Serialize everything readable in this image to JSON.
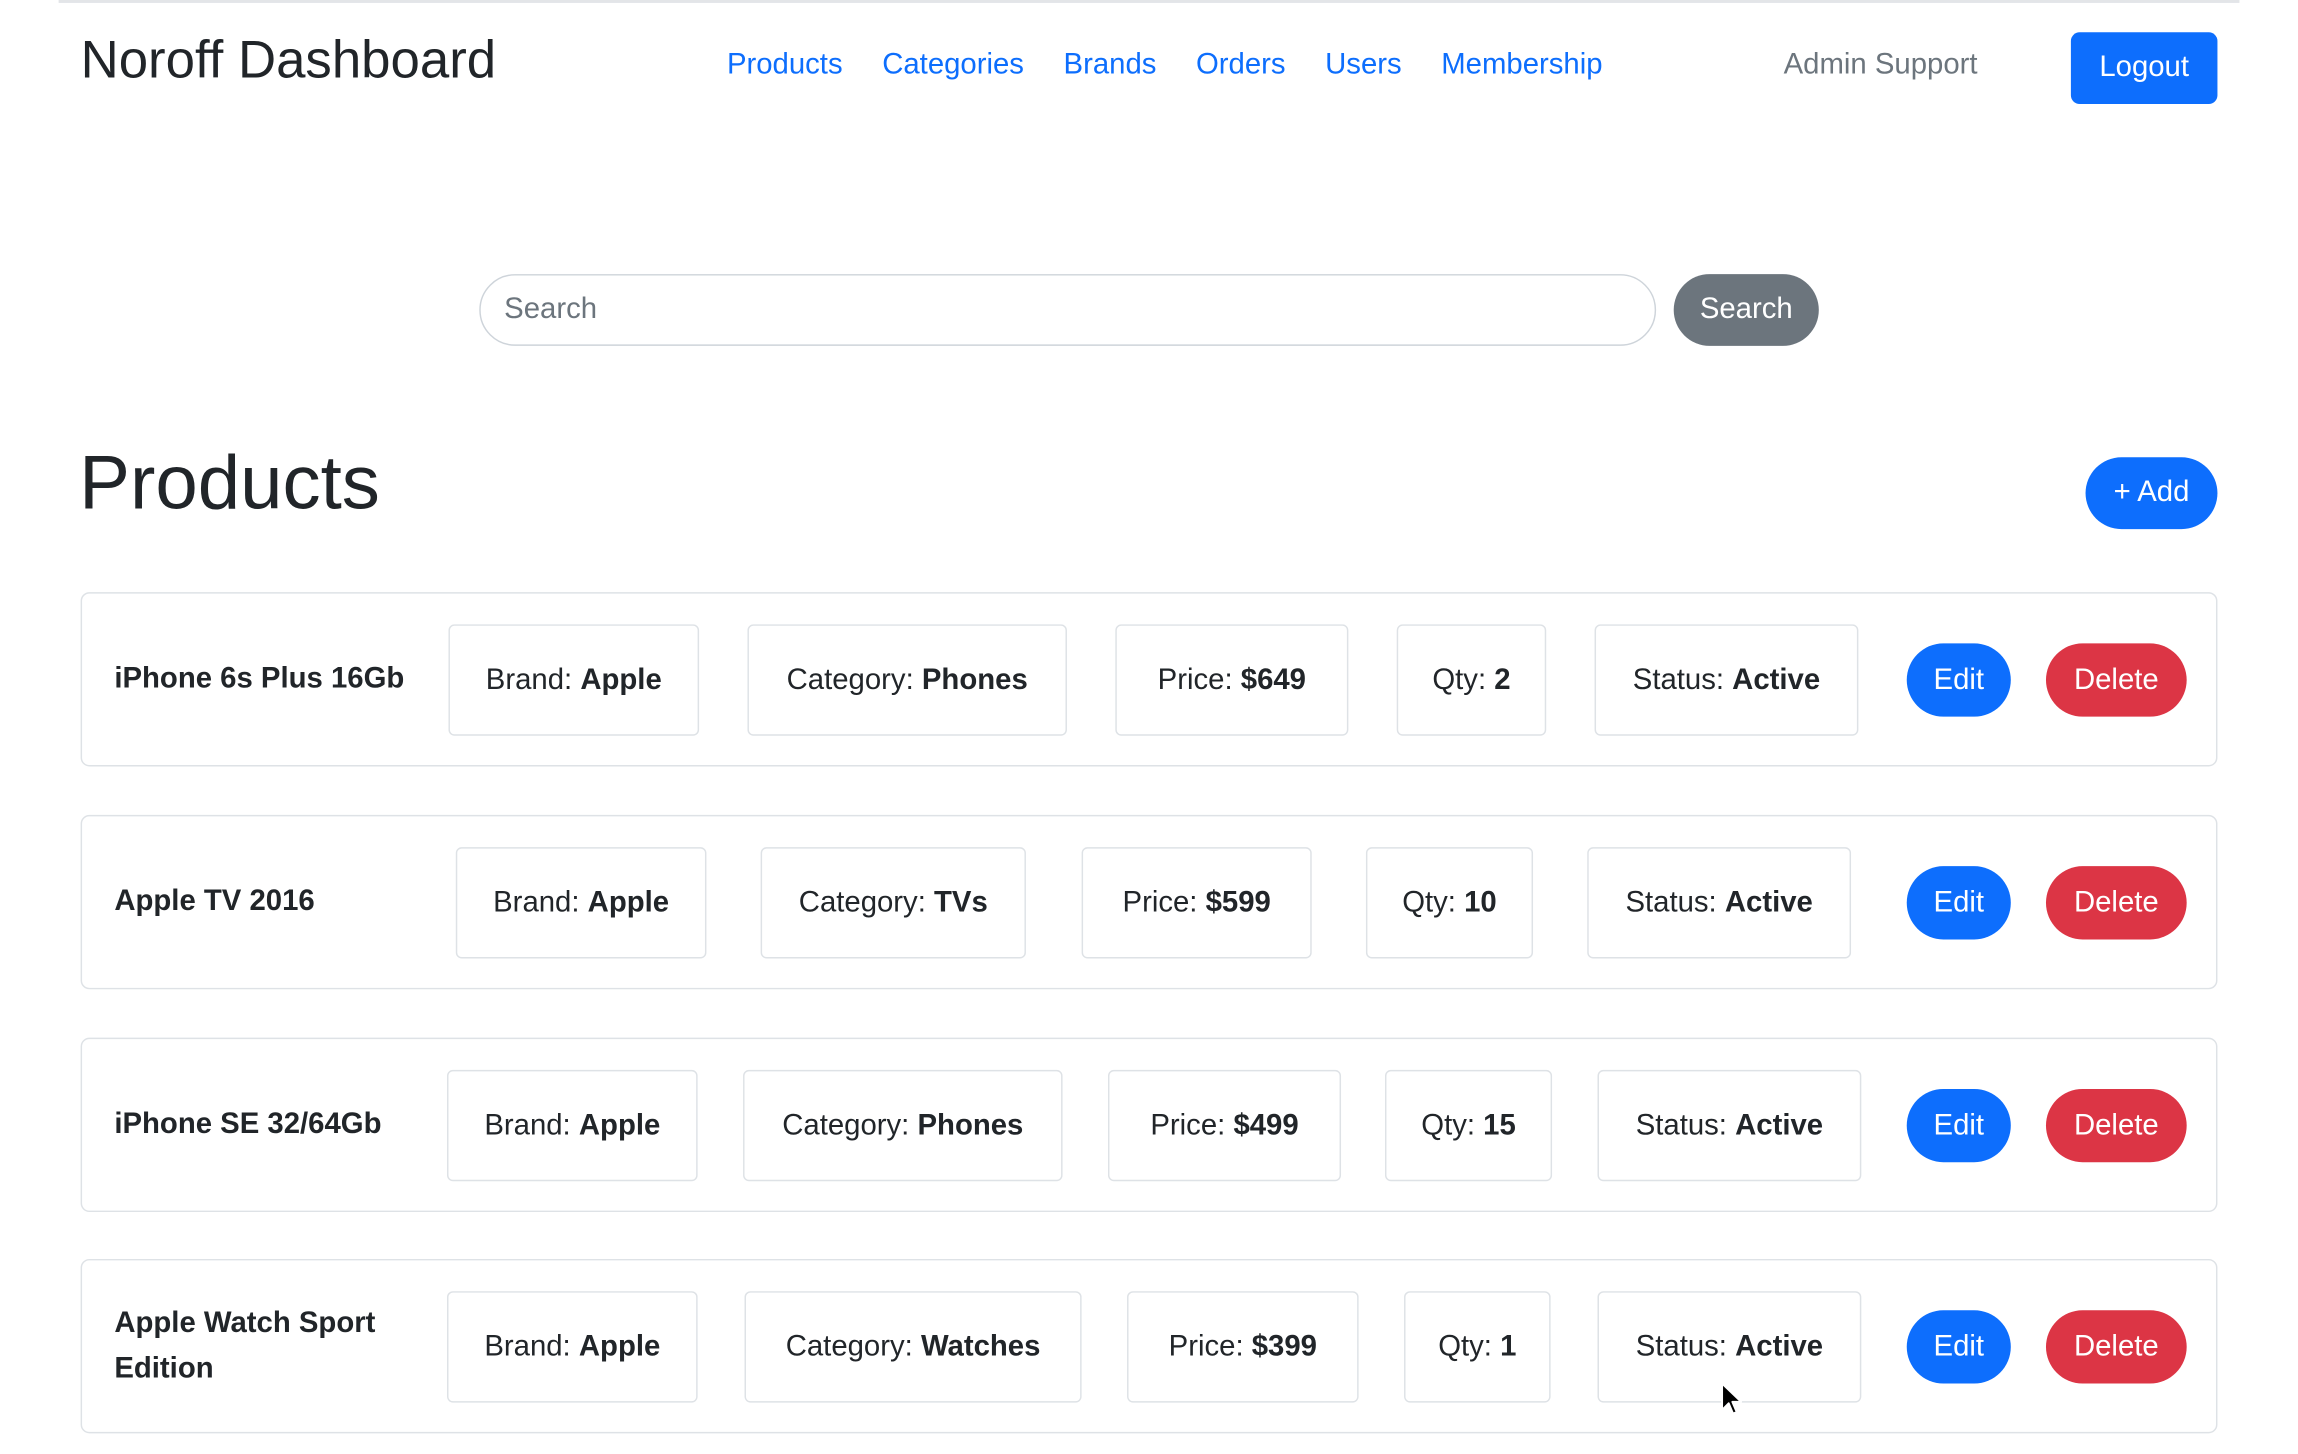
{
  "header": {
    "brand": "Noroff Dashboard",
    "nav": [
      "Products",
      "Categories",
      "Brands",
      "Orders",
      "Users",
      "Membership"
    ],
    "support": "Admin Support",
    "logout": "Logout"
  },
  "search": {
    "placeholder": "Search",
    "value": "",
    "button": "Search"
  },
  "main": {
    "title": "Products",
    "add_label": "+ Add"
  },
  "labels": {
    "brand": "Brand:",
    "category": "Category:",
    "price": "Price:",
    "qty": "Qty:",
    "status": "Status:",
    "edit": "Edit",
    "delete": "Delete"
  },
  "products": [
    {
      "name": "iPhone 6s Plus 16Gb",
      "brand": "Apple",
      "category": "Phones",
      "price": "$649",
      "qty": "2",
      "status": "Active"
    },
    {
      "name": "Apple TV 2016",
      "brand": "Apple",
      "category": "TVs",
      "price": "$599",
      "qty": "10",
      "status": "Active"
    },
    {
      "name": "iPhone SE 32/64Gb",
      "brand": "Apple",
      "category": "Phones",
      "price": "$499",
      "qty": "15",
      "status": "Active"
    },
    {
      "name": "Apple Watch Sport Edition",
      "brand": "Apple",
      "category": "Watches",
      "price": "$399",
      "qty": "1",
      "status": "Active"
    }
  ],
  "colors": {
    "primary": "#0d6efd",
    "secondary": "#6c757d",
    "danger": "#dc3545",
    "border": "#dee2e6",
    "text": "#212529"
  }
}
